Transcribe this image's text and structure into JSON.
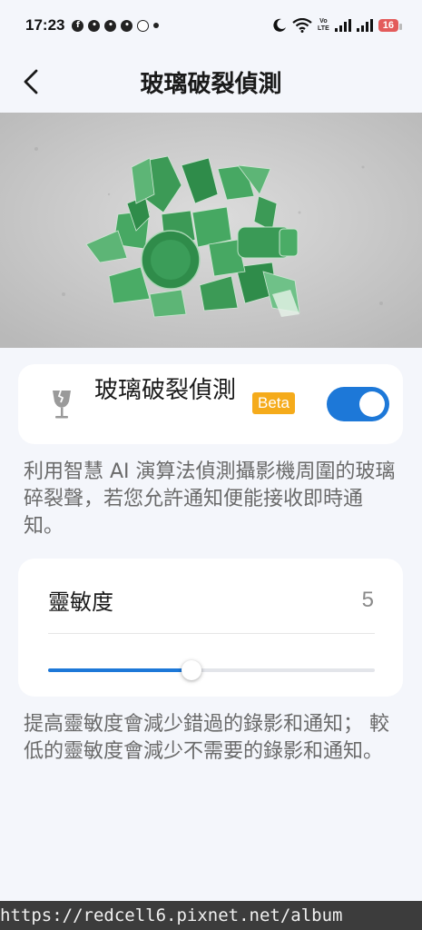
{
  "status_bar": {
    "time": "17:23",
    "battery": "16",
    "volte_line1": "Vo",
    "volte_line2": "LTE"
  },
  "header": {
    "title": "玻璃破裂偵測"
  },
  "hero": {
    "icon": "broken-glass-photo"
  },
  "feature": {
    "title": "玻璃破裂偵測",
    "badge": "Beta",
    "enabled": true,
    "description": "利用智慧 AI 演算法偵測攝影機周圍的玻璃碎裂聲，若您允許通知便能接收即時通知。"
  },
  "sensitivity": {
    "label": "靈敏度",
    "value": "5",
    "level": 0.44,
    "description": "提高靈敏度會減少錯過的錄影和通知； 較低的靈敏度會減少不需要的錄影和通知。"
  },
  "watermark": {
    "text": "https://redcell6.pixnet.net/album"
  },
  "colors": {
    "accent": "#1d78d8",
    "beta": "#f5ab1b",
    "background": "#f4f6fb",
    "battery": "#e35b5b"
  }
}
